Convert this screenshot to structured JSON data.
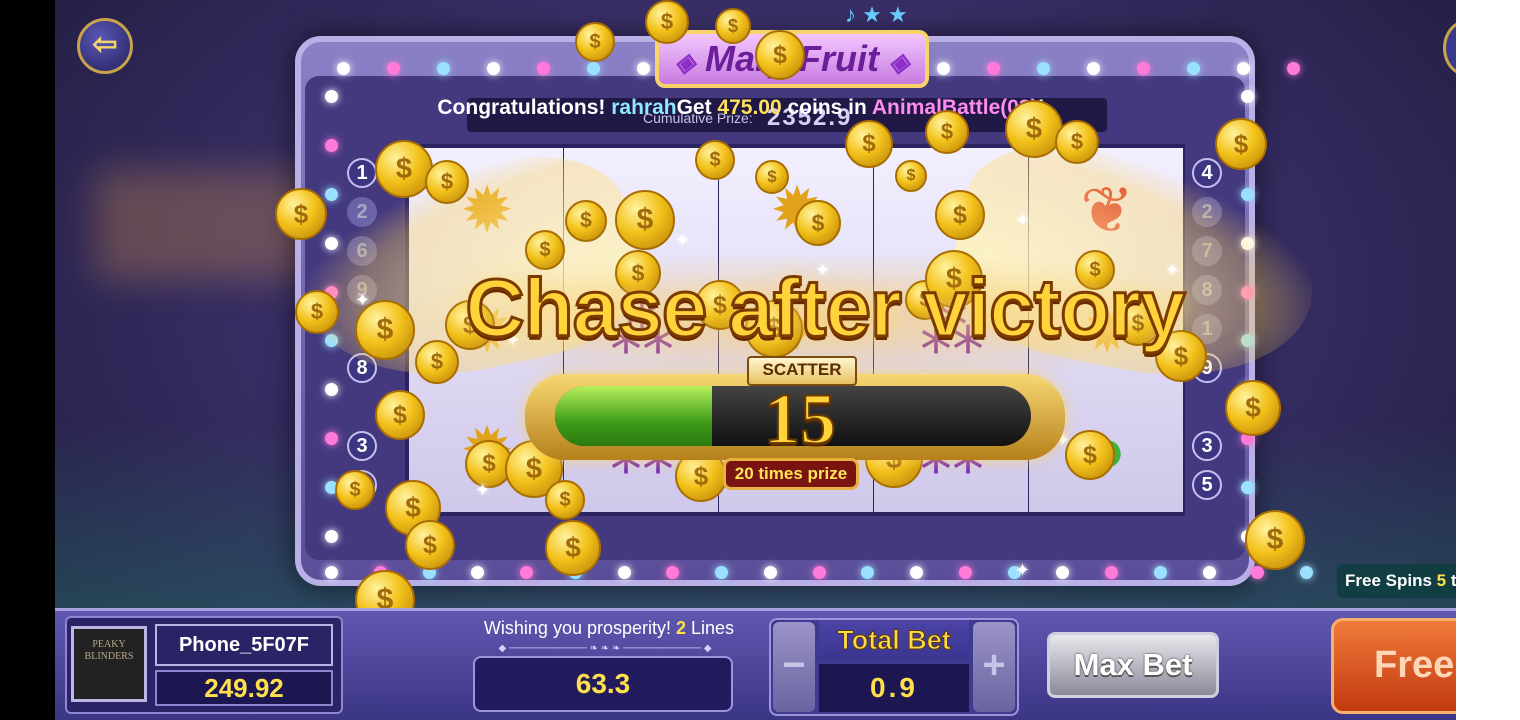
{
  "game": {
    "title": "Mary Fruit",
    "title_icon": "diamond-icon",
    "back_icon": "exit-arrow-icon",
    "cumulative_label": "Cumulative Prize:",
    "cumulative_value": "2352.9"
  },
  "marquee": {
    "prefix": "Congratulations! ",
    "player": "rahrah",
    "mid": "Get ",
    "amount": "475.00",
    "mid2": " coins in ",
    "game": "AnimalBattle(03)",
    "suffix": "!"
  },
  "reels": [
    [
      "pineapple",
      "pineapple",
      "pineapple"
    ],
    [
      "apple",
      "grape",
      "grape"
    ],
    [
      "pineapple",
      "scatter",
      "grape"
    ],
    [
      "apple",
      "grape",
      "grape"
    ],
    [
      "cherry",
      "pineapple",
      "apple"
    ]
  ],
  "symbols": {
    "pineapple": "✹",
    "apple": "●",
    "cherry": "❦",
    "grape": "⁂",
    "scatter": "✦"
  },
  "paylines_left": [
    "1",
    "2",
    "6",
    "9",
    "",
    "8",
    "",
    "3",
    "5"
  ],
  "paylines_right": [
    "4",
    "2",
    "7",
    "8",
    "1",
    "9",
    "",
    "3",
    "5"
  ],
  "overlay": {
    "headline": "Chase after victory",
    "scatter_label": "SCATTER",
    "count": "15",
    "progress": 0.33,
    "prize_label": "20 times prize"
  },
  "free_spins": {
    "label": "Free Spins ",
    "count": "5",
    "trailing": " t"
  },
  "player": {
    "name": "Phone_5F07F",
    "balance": "249.92",
    "avatar_text": "PEAKY BLINDERS"
  },
  "lines": {
    "label_prefix": "Wishing you prosperity! ",
    "count": "2",
    "label_suffix": " Lines",
    "value": "63.3"
  },
  "bet": {
    "title": "Total Bet",
    "value": "0.9",
    "minus": "−",
    "plus": "+"
  },
  "buttons": {
    "max_bet": "Max Bet",
    "free": "Free"
  },
  "colors": {
    "accent_gold": "#ffe04a",
    "progress_green": "#3f9c1a",
    "machine_purple": "#5b4e99"
  }
}
